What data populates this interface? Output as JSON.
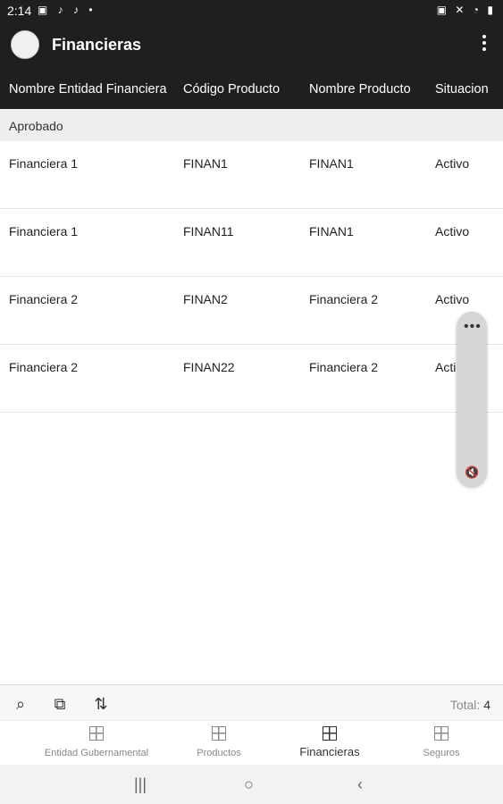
{
  "status_bar": {
    "time": "2:14",
    "left_icons": "▣ ♪ ♪ •",
    "right_icons": "▣ ✕ ◔ ▮"
  },
  "app_bar": {
    "title": "Financieras"
  },
  "table": {
    "headers": [
      "Nombre Entidad Financiera",
      "Código Producto",
      "Nombre Producto",
      "Situacion"
    ],
    "group_label": "Aprobado",
    "rows": [
      [
        "Financiera 1",
        "FINAN1",
        "FINAN1",
        "Activo"
      ],
      [
        "Financiera 1",
        "FINAN11",
        "FINAN1",
        "Activo"
      ],
      [
        "Financiera 2",
        "FINAN2",
        "Financiera 2",
        "Activo"
      ],
      [
        "Financiera 2",
        "FINAN22",
        "Financiera 2",
        "Acti"
      ]
    ]
  },
  "floating_panel": {
    "dots": "•••",
    "mute_icon": "🔇"
  },
  "toolbar": {
    "search_icon": "⌕",
    "copy_icon": "⧉",
    "sort_icon": "⇅",
    "total_label": "Total:",
    "total_value": "4"
  },
  "bottom_nav": {
    "items": [
      {
        "label": "Entidad Gubernamental"
      },
      {
        "label": "Productos"
      },
      {
        "label": "Financieras"
      },
      {
        "label": "Seguros"
      }
    ]
  },
  "system_nav": {
    "recents": "|||",
    "home": "○",
    "back": "‹"
  }
}
